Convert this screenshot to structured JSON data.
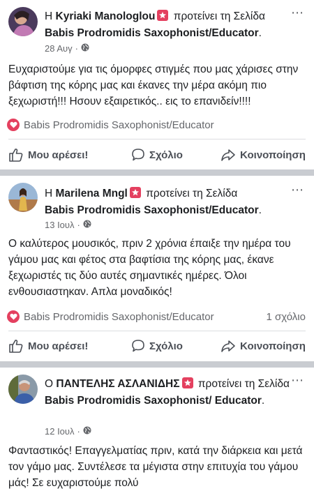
{
  "posts": [
    {
      "author": "Kyriaki Manologlou",
      "article": "Η",
      "recommends": "προτείνει τη Σελίδα",
      "page": "Babis Prodromidis Saxophonist/Educator",
      "page_suffix": ".",
      "date": "28 Αυγ",
      "text": "Ευχαριστούμε για τις όμορφες στιγμές που μας χάρισες στην βάφτιση της κόρης μας και έκανες την μέρα ακόμη πιο ξεχωριστή!!! Ησουν εξαιρετικός.. εις το επανιδείν!!!!",
      "rec_page": "Babis Prodromidis Saxophonist/Educator",
      "comment_count": ""
    },
    {
      "author": "Marilena Mngl",
      "article": "Η",
      "recommends": "προτείνει τη Σελίδα",
      "page": "Babis Prodromidis Saxophonist/Educator",
      "page_suffix": ".",
      "date": "13 Ιουλ",
      "text": "Ο καλύτερος μουσικός, πριν 2 χρόνια έπαιξε την ημέρα του γάμου μας και φέτος στα βαφτίσια της κόρης μας, έκανε ξεχωριστές τις δύο αυτές σημαντικές ημέρες. Όλοι ενθουσιαστηκαν. Απλα μοναδικός!",
      "rec_page": "Babis Prodromidis Saxophonist/Educator",
      "comment_count": "1 σχόλιο"
    },
    {
      "author": "ΠΑΝΤΕΛΗΣ ΑΣΛΑΝΙΔΗΣ",
      "article": "Ο",
      "recommends": "προτείνει τη Σελίδα",
      "page": "Babis Prodromidis Saxophonist/ Educator",
      "page_suffix": ".",
      "date": "12 Ιουλ",
      "text": "Φανταστικός! Επαγγελματίας πριν, κατά την διάρκεια και μετά τον γάμο μας. Συντέλεσε τα μέγιστα στην επιτυχία του γάμου μάς! Σε ευχαριστούμε πολύ"
    }
  ],
  "actions": {
    "like": "Μου αρέσει!",
    "comment": "Σχόλιο",
    "share": "Κοινοποίηση"
  },
  "more_icon": "⋯",
  "colors": {
    "recommend_red": "#e4405f",
    "separator": "#c9ccd1",
    "muted": "#65676b"
  }
}
